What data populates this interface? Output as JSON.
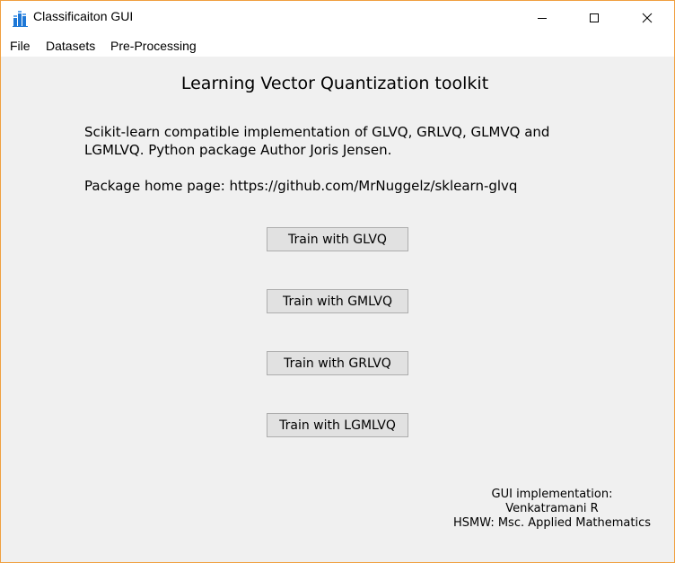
{
  "window": {
    "title": "Classificaiton GUI",
    "border_color": "#f0a040"
  },
  "menu": {
    "items": [
      "File",
      "Datasets",
      "Pre-Processing"
    ]
  },
  "main": {
    "heading": "Learning Vector Quantization toolkit",
    "description_line1": "Scikit-learn compatible implementation of GLVQ, GRLVQ, GLMVQ and",
    "description_line2": "LGMLVQ. Python package Author Joris Jensen.",
    "homepage": "Package home page: https://github.com/MrNuggelz/sklearn-glvq",
    "buttons": [
      "Train with GLVQ",
      "Train with GMLVQ",
      "Train with GRLVQ",
      "Train with LGMLVQ"
    ]
  },
  "credits": {
    "line1": "GUI implementation:",
    "line2": "Venkatramani R",
    "line3": "HSMW: Msc. Applied Mathematics"
  },
  "icons": {
    "app": "bar-chart-icon",
    "minimize": "minimize-icon",
    "maximize": "maximize-icon",
    "close": "close-icon"
  }
}
